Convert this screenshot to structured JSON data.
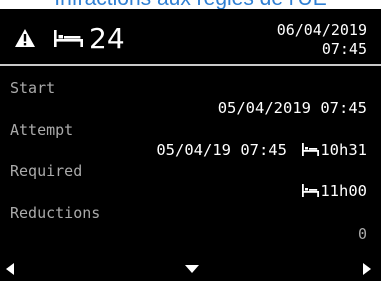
{
  "banner": {
    "text": "Infractions aux règles de l'UE"
  },
  "header": {
    "count": "24",
    "date": "06/04/2019",
    "time": "07:45"
  },
  "rows": {
    "start_label": "Start",
    "start_value": "05/04/2019 07:45",
    "attempt_label": "Attempt",
    "attempt_value": "05/04/19 07:45",
    "attempt_duration": "10h31",
    "required_label": "Required",
    "required_duration": "11h00",
    "reductions_label": "Reductions",
    "reductions_value": "0"
  },
  "icons": {
    "warning": "warning-triangle-icon",
    "rest": "bed-rest-icon",
    "left": "arrow-left-icon",
    "down": "arrow-down-icon",
    "right": "arrow-right-icon"
  }
}
